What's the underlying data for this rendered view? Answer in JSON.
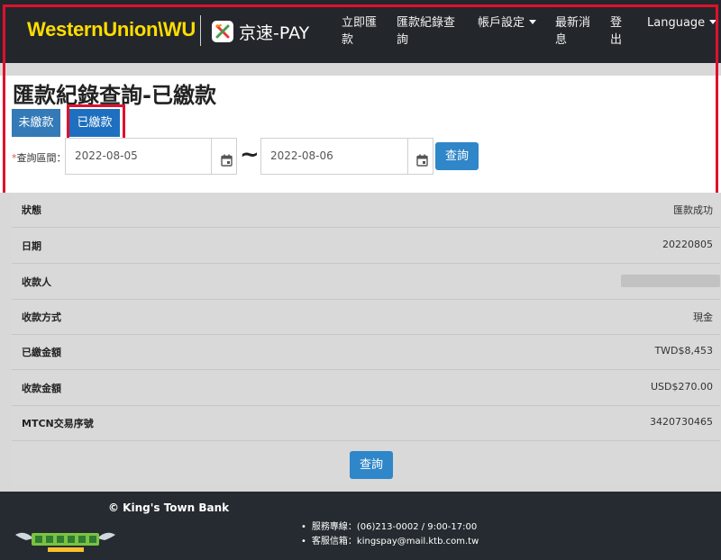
{
  "brand": {
    "wu_logo": "WesternUnion\\WU",
    "kp_logo": "京速-PAY"
  },
  "nav": {
    "items": [
      {
        "label": "立即匯款",
        "dropdown": false
      },
      {
        "label": "匯款紀錄查詢",
        "dropdown": false
      },
      {
        "label": "帳戶設定",
        "dropdown": true
      },
      {
        "label": "最新消息",
        "dropdown": false
      },
      {
        "label": "登出",
        "dropdown": false
      },
      {
        "label": "Language",
        "dropdown": true
      }
    ]
  },
  "page": {
    "title": "匯款紀錄查詢-已繳款",
    "tabs": [
      {
        "label": "未繳款",
        "active": false
      },
      {
        "label": "已繳款",
        "active": true
      }
    ]
  },
  "filter": {
    "label": "查詢區間：",
    "required_mark": "*",
    "date_from": "2022-08-05",
    "date_to": "2022-08-06",
    "separator": "~",
    "query_label": "查詢"
  },
  "result": {
    "rows": [
      {
        "label": "狀態",
        "value": "匯款成功"
      },
      {
        "label": "日期",
        "value": "20220805"
      },
      {
        "label": "收款人",
        "value": "",
        "redacted": true
      },
      {
        "label": "收款方式",
        "value": "現金"
      },
      {
        "label": "已繳金額",
        "value": "TWD$8,453"
      },
      {
        "label": "收款金額",
        "value": "USD$270.00"
      },
      {
        "label": "MTCN交易序號",
        "value": "3420730465"
      }
    ],
    "query_label": "查詢"
  },
  "footer": {
    "copyright": "© King's Town Bank",
    "service_line": "服務專線：(06)213-0002 / 9:00-17:00",
    "service_email": "客服信箱：kingspay@mail.ktb.com.tw"
  },
  "colors": {
    "navbar": "#23272b",
    "wu_yellow": "#ffdd00",
    "primary": "#337ab7",
    "highlight": "#e0102d"
  }
}
